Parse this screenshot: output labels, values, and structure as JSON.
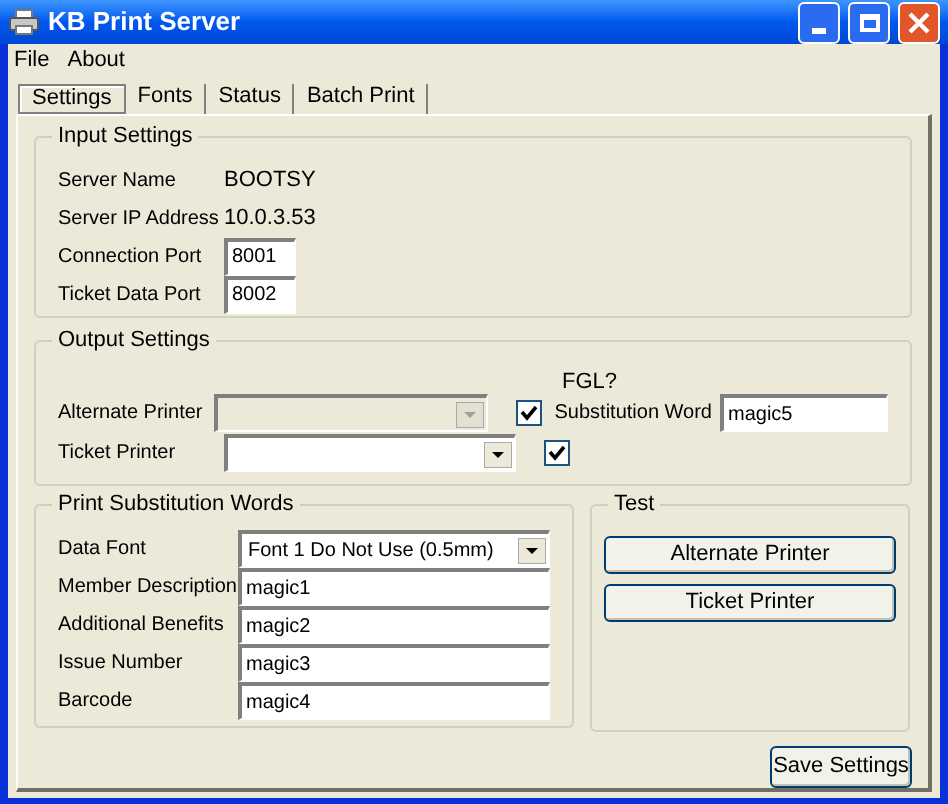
{
  "window": {
    "title": "KB Print Server"
  },
  "menu": [
    {
      "label": "File"
    },
    {
      "label": "About"
    }
  ],
  "tabs": [
    {
      "label": "Settings",
      "selected": true
    },
    {
      "label": "Fonts",
      "selected": false
    },
    {
      "label": "Status",
      "selected": false
    },
    {
      "label": "Batch Print",
      "selected": false
    }
  ],
  "input_settings": {
    "title": "Input Settings",
    "rows": [
      {
        "kind": "text",
        "label": "Server Name",
        "value": "BOOTSY"
      },
      {
        "kind": "text",
        "label": "Server IP Address",
        "value": "10.0.3.53"
      },
      {
        "kind": "field",
        "label": "Connection Port",
        "value": "8001"
      },
      {
        "kind": "field",
        "label": "Ticket Data Port",
        "value": "8002"
      }
    ]
  },
  "output_settings": {
    "title": "Output Settings",
    "fgl_header": "FGL?",
    "rows": [
      {
        "label": "Alternate Printer",
        "disabled": true,
        "fgl_checked": true
      },
      {
        "label": "Ticket Printer",
        "disabled": false,
        "fgl_checked": true
      }
    ],
    "substitution_word": {
      "label": "Substitution Word",
      "value": "magic5"
    }
  },
  "print_substitution_words": {
    "title": "Print Substitution Words",
    "rows": [
      {
        "kind": "select",
        "label": "Data Font",
        "value": "Font 1 Do Not Use (0.5mm)"
      },
      {
        "kind": "field",
        "label": "Member Description",
        "value": "magic1"
      },
      {
        "kind": "field",
        "label": "Additional Benefits",
        "value": "magic2"
      },
      {
        "kind": "field",
        "label": "Issue Number",
        "value": "magic3"
      },
      {
        "kind": "field",
        "label": "Barcode",
        "value": "magic4"
      }
    ]
  },
  "test": {
    "title": "Test",
    "buttons": [
      "Alternate Printer",
      "Ticket Printer"
    ]
  },
  "save_button": "Save Settings"
}
